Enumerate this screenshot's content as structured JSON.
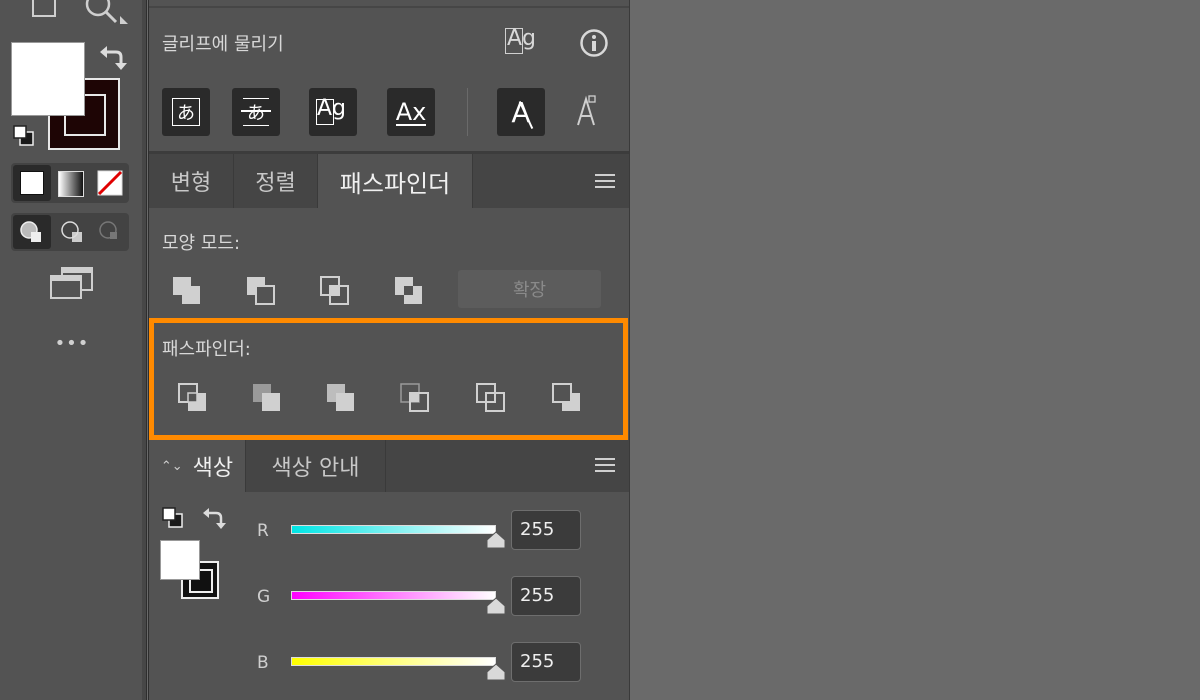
{
  "glyph_section": {
    "title": "글리프에 물리기",
    "buttons": [
      "あ",
      "あ",
      "Ag",
      "Ax",
      "A"
    ]
  },
  "tabs_top": {
    "items": [
      "변형",
      "정렬",
      "패스파인더"
    ]
  },
  "shape_modes": {
    "label": "모양 모드:",
    "expand_label": "확장"
  },
  "pathfinder": {
    "label": "패스파인더:",
    "highlight_color": "#ff8a00"
  },
  "color_tabs": {
    "items": [
      "색상",
      "색상 안내"
    ]
  },
  "color": {
    "channels": [
      {
        "name": "R",
        "value": "255",
        "gradient_start": "#00e5e5"
      },
      {
        "name": "G",
        "value": "255",
        "gradient_start": "#ff00ff"
      },
      {
        "name": "B",
        "value": "255",
        "gradient_start": "#ffff00"
      }
    ]
  },
  "toolbar": {
    "more_label": "•••"
  }
}
